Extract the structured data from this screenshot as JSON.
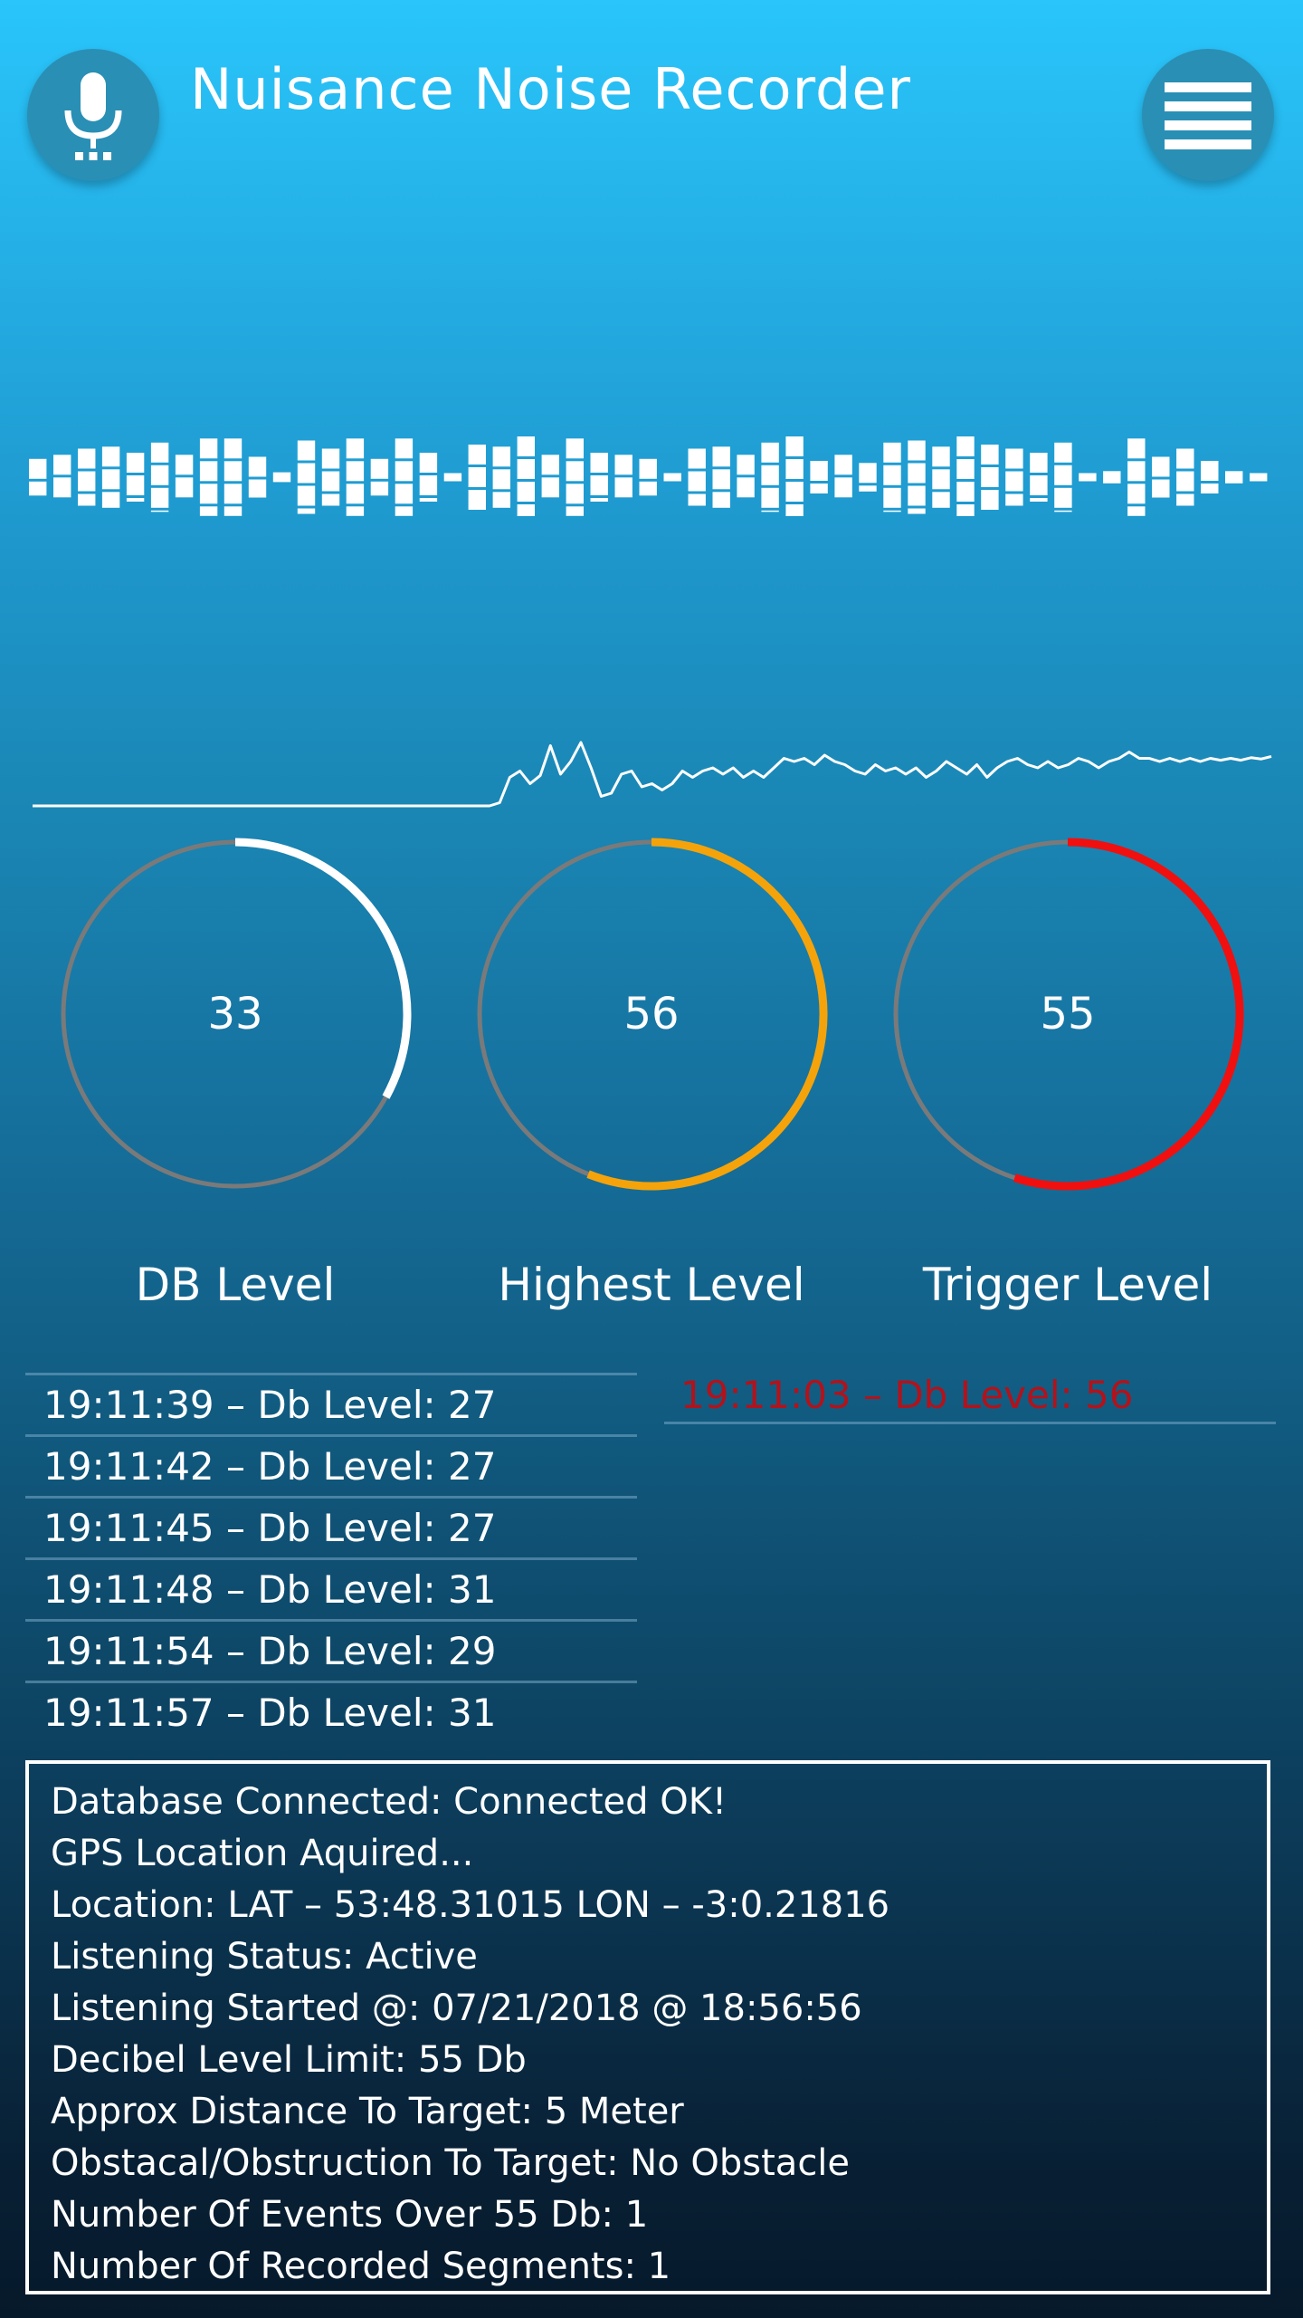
{
  "header": {
    "title": "Nuisance Noise Recorder",
    "mic_icon": "microphone-icon",
    "menu_icon": "hamburger-menu-icon"
  },
  "colors": {
    "gauge_track": "#7a7a7a",
    "db_level": "#ffffff",
    "highest_level": "#f5a30a",
    "trigger_level": "#f01010",
    "trigger_event_text": "#b3121b"
  },
  "equalizer": {
    "levels": [
      0.45,
      0.55,
      0.7,
      0.75,
      0.6,
      0.85,
      0.55,
      0.95,
      0.95,
      0.5,
      0.12,
      0.9,
      0.7,
      0.95,
      0.45,
      0.95,
      0.6,
      0.1,
      0.8,
      0.75,
      1.0,
      0.55,
      0.95,
      0.6,
      0.55,
      0.45,
      0.1,
      0.7,
      0.75,
      0.55,
      0.85,
      1.0,
      0.4,
      0.55,
      0.35,
      0.85,
      0.9,
      0.75,
      1.0,
      0.8,
      0.7,
      0.6,
      0.85,
      0.1,
      0.15,
      0.95,
      0.5,
      0.7,
      0.4,
      0.15,
      0.1
    ]
  },
  "waveform": {
    "samples": [
      0,
      0,
      0,
      0,
      0,
      0,
      0,
      0,
      0,
      0,
      0,
      0,
      0,
      0,
      0,
      0,
      0,
      0,
      0,
      0,
      0,
      0,
      0,
      0,
      0,
      0,
      0,
      0,
      0,
      0,
      0,
      0,
      0,
      0,
      0,
      0,
      0,
      0,
      0,
      0,
      0,
      0,
      0,
      0,
      0,
      0,
      0.05,
      0.45,
      0.55,
      0.35,
      0.48,
      0.95,
      0.5,
      0.7,
      1.0,
      0.6,
      0.15,
      0.2,
      0.5,
      0.55,
      0.3,
      0.35,
      0.25,
      0.35,
      0.55,
      0.45,
      0.55,
      0.6,
      0.5,
      0.6,
      0.45,
      0.55,
      0.45,
      0.6,
      0.75,
      0.7,
      0.75,
      0.65,
      0.8,
      0.7,
      0.65,
      0.55,
      0.5,
      0.65,
      0.55,
      0.6,
      0.5,
      0.6,
      0.45,
      0.55,
      0.7,
      0.6,
      0.5,
      0.65,
      0.45,
      0.6,
      0.7,
      0.75,
      0.65,
      0.6,
      0.7,
      0.6,
      0.65,
      0.75,
      0.7,
      0.6,
      0.7,
      0.75,
      0.85,
      0.75,
      0.75,
      0.7,
      0.75,
      0.7,
      0.75,
      0.7,
      0.75,
      0.72,
      0.75,
      0.72,
      0.76,
      0.74,
      0.78
    ]
  },
  "gauges": [
    {
      "id": "db",
      "value": "33",
      "max": 100,
      "label": "DB Level"
    },
    {
      "id": "high",
      "value": "56",
      "max": 100,
      "label": "Highest  Level"
    },
    {
      "id": "trig",
      "value": "55",
      "max": 100,
      "label": "Trigger Level"
    }
  ],
  "events": [
    "19:11:39 – Db Level: 27",
    "19:11:42 – Db Level: 27",
    "19:11:45 – Db Level: 27",
    "19:11:48 – Db Level: 31",
    "19:11:54 – Db Level: 29",
    "19:11:57 – Db Level: 31"
  ],
  "trigger_events": [
    "19:11:03 – Db Level: 56"
  ],
  "status": [
    "Database Connected: Connected OK!",
    "GPS Location Aquired...",
    "Location: LAT – 53:48.31015 LON – -3:0.21816",
    "Listening Status: Active",
    "Listening Started @: 07/21/2018 @ 18:56:56",
    "Decibel Level Limit: 55 Db",
    "Approx Distance To Target: 5 Meter",
    "Obstacal/Obstruction To Target: No Obstacle",
    "Number Of Events Over 55 Db: 1",
    "Number Of Recorded Segments: 1"
  ]
}
